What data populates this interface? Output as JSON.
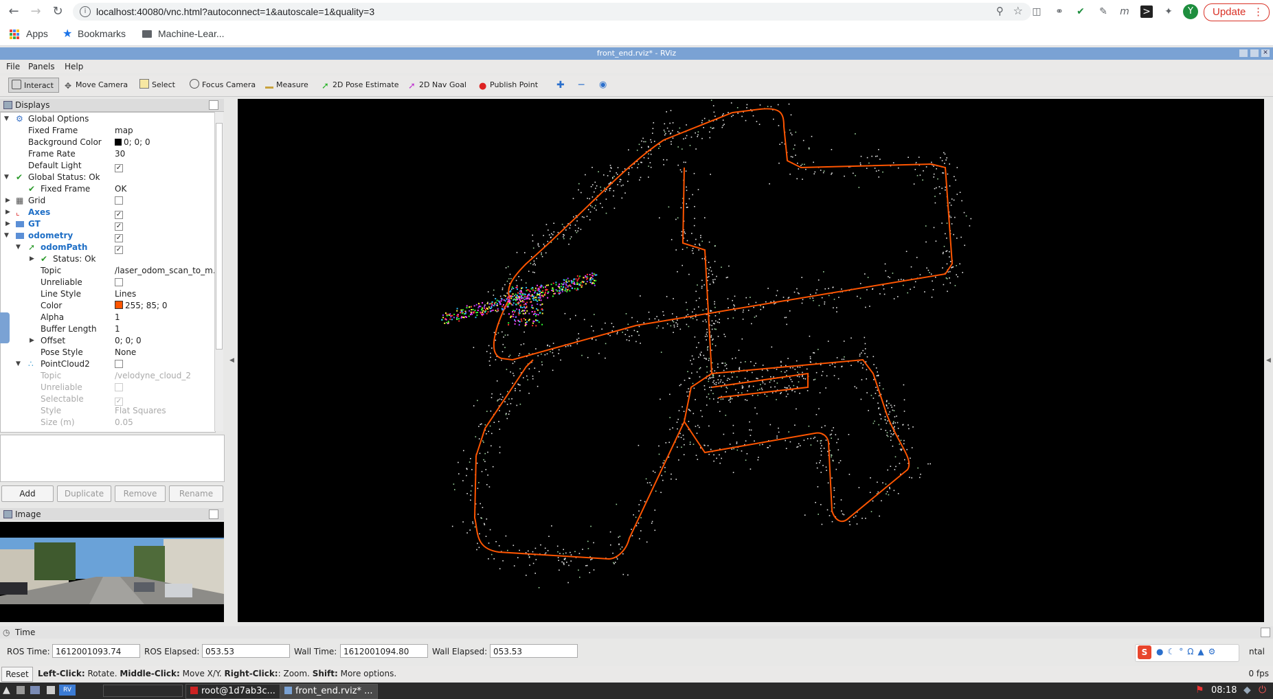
{
  "browser": {
    "url": "localhost:40080/vnc.html?autoconnect=1&autoscale=1&quality=3",
    "update_label": "Update",
    "avatar_letter": "Y",
    "bookmarks": [
      "Apps",
      "Bookmarks",
      "Machine-Lear..."
    ]
  },
  "window": {
    "title": "front_end.rviz* - RViz",
    "menu": [
      "File",
      "Panels",
      "Help"
    ]
  },
  "toolbar": {
    "tools": [
      "Interact",
      "Move Camera",
      "Select",
      "Focus Camera",
      "Measure",
      "2D Pose Estimate",
      "2D Nav Goal",
      "Publish Point"
    ]
  },
  "displays": {
    "title": "Displays",
    "rows": [
      {
        "name": "Global Options",
        "value": ""
      },
      {
        "name": "Fixed Frame",
        "value": "map"
      },
      {
        "name": "Background Color",
        "value": "0; 0; 0"
      },
      {
        "name": "Frame Rate",
        "value": "30"
      },
      {
        "name": "Default Light",
        "value": ""
      },
      {
        "name": "Global Status: Ok",
        "value": ""
      },
      {
        "name": "Fixed Frame",
        "value": "OK"
      },
      {
        "name": "Grid",
        "value": ""
      },
      {
        "name": "Axes",
        "value": ""
      },
      {
        "name": "GT",
        "value": ""
      },
      {
        "name": "odometry",
        "value": ""
      },
      {
        "name": "odomPath",
        "value": ""
      },
      {
        "name": "Status: Ok",
        "value": ""
      },
      {
        "name": "Topic",
        "value": "/laser_odom_scan_to_m..."
      },
      {
        "name": "Unreliable",
        "value": ""
      },
      {
        "name": "Line Style",
        "value": "Lines"
      },
      {
        "name": "Color",
        "value": "255; 85; 0"
      },
      {
        "name": "Alpha",
        "value": "1"
      },
      {
        "name": "Buffer Length",
        "value": "1"
      },
      {
        "name": "Offset",
        "value": "0; 0; 0"
      },
      {
        "name": "Pose Style",
        "value": "None"
      },
      {
        "name": "PointCloud2",
        "value": ""
      },
      {
        "name": "Topic",
        "value": "/velodyne_cloud_2"
      },
      {
        "name": "Unreliable",
        "value": ""
      },
      {
        "name": "Selectable",
        "value": ""
      },
      {
        "name": "Style",
        "value": "Flat Squares"
      },
      {
        "name": "Size (m)",
        "value": "0.05"
      }
    ],
    "buttons": [
      "Add",
      "Duplicate",
      "Remove",
      "Rename"
    ]
  },
  "image_panel": {
    "title": "Image"
  },
  "time": {
    "title": "Time",
    "ros_time_label": "ROS Time:",
    "ros_time": "1612001093.74",
    "ros_elapsed_label": "ROS Elapsed:",
    "ros_elapsed": "053.53",
    "wall_time_label": "Wall Time:",
    "wall_time": "1612001094.80",
    "wall_elapsed_label": "Wall Elapsed:",
    "wall_elapsed": "053.53",
    "experimental": "ntal"
  },
  "status": {
    "reset": "Reset",
    "hint_lc": "Left-Click:",
    "hint_lc_t": "Rotate.",
    "hint_mc": "Middle-Click:",
    "hint_mc_t": "Move X/Y.",
    "hint_rc": "Right-Click:",
    "hint_rc_t": ": Zoom.",
    "hint_sh": "Shift:",
    "hint_sh_t": "More options.",
    "fps": "0 fps"
  },
  "taskbar": {
    "tasks": [
      "root@1d7ab3c...",
      "front_end.rviz* ..."
    ],
    "clock": "08:18"
  },
  "colors": {
    "path": "#ff5500",
    "accent": "#7aa2d4"
  }
}
